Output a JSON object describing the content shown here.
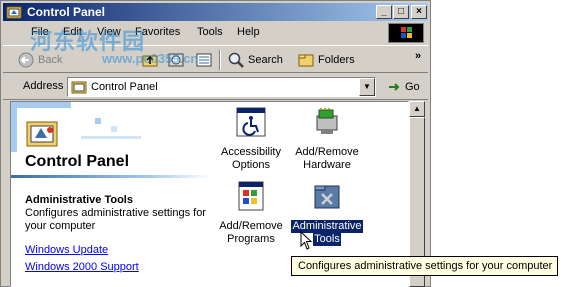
{
  "window": {
    "title": "Control Panel",
    "buttons": {
      "minimize": "_",
      "maximize": "□",
      "close": "×"
    }
  },
  "menu": [
    "File",
    "Edit",
    "View",
    "Favorites",
    "Tools",
    "Help"
  ],
  "toolbar": {
    "back": "Back",
    "search": "Search",
    "folders": "Folders",
    "more": "»"
  },
  "address": {
    "label": "Address",
    "value": "Control Panel",
    "go": "Go"
  },
  "leftpane": {
    "title": "Control Panel",
    "heading": "Administrative Tools",
    "description": "Configures administrative settings for your computer",
    "links": [
      "Windows Update",
      "Windows 2000 Support"
    ]
  },
  "items": [
    {
      "label1": "Accessibility",
      "label2": "Options",
      "icon": "accessibility-icon"
    },
    {
      "label1": "Add/Remove",
      "label2": "Hardware",
      "icon": "hardware-icon"
    },
    {
      "label1": "Add/Remove",
      "label2": "Programs",
      "icon": "programs-icon"
    },
    {
      "label1": "Administrative",
      "label2": "Tools",
      "icon": "admin-tools-icon"
    }
  ],
  "tooltip": "Configures administrative settings for your computer",
  "watermark": {
    "line1": "河东软件园",
    "line2": "www.pc0359.cn"
  },
  "colors": {
    "titlebar": "#0a246a",
    "selection": "#0a246a",
    "link": "#0000ff",
    "tooltip_bg": "#ffffe1"
  }
}
